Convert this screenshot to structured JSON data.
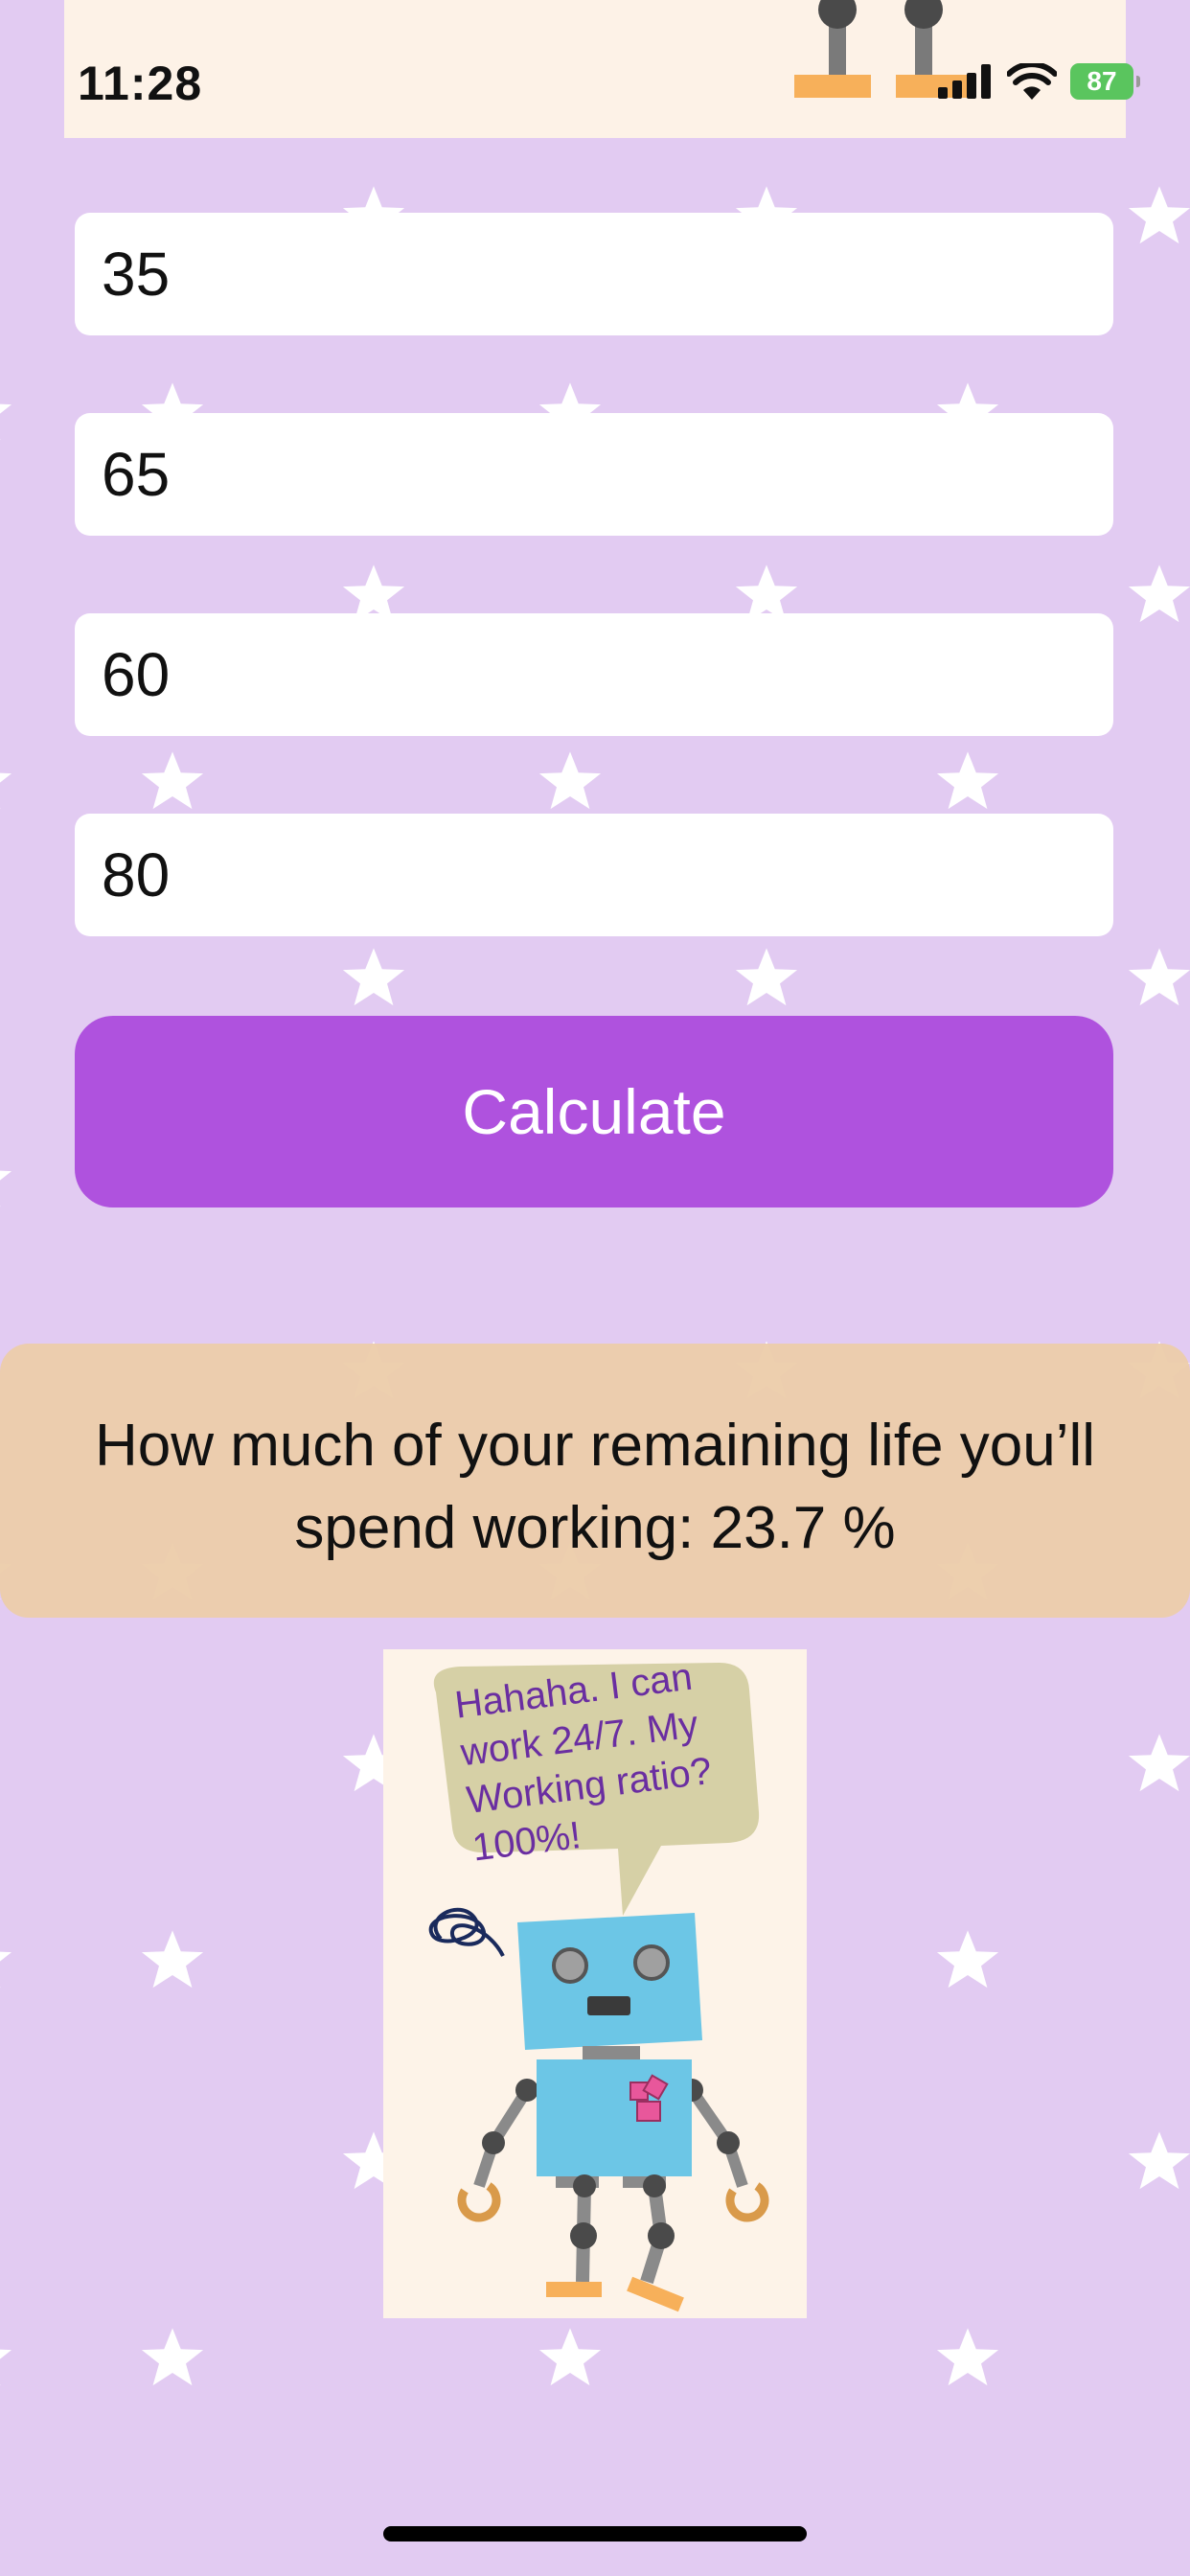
{
  "status_bar": {
    "time": "11:28",
    "battery": "87",
    "icons": [
      "cellular-signal-icon",
      "wifi-icon",
      "battery-charging-icon"
    ]
  },
  "form": {
    "fields": [
      {
        "value": "35"
      },
      {
        "value": "65"
      },
      {
        "value": "60"
      },
      {
        "value": "80"
      }
    ],
    "calculate_label": "Calculate"
  },
  "result": {
    "text_line1": "How much of your remaining life you’ll",
    "text_line2": "spend working: 23.7 %"
  },
  "robot_card": {
    "speech": [
      "Hahaha. I can",
      "work 24/7. My",
      "Working ratio?",
      "100%!"
    ]
  },
  "colors": {
    "background": "#e2cbf2",
    "accent_button": "#af52de",
    "result_panel": "#eccca9",
    "robot_body": "#6cc6e6",
    "speech_bubble": "#d6d0a6",
    "speech_text": "#6a2ea1"
  }
}
